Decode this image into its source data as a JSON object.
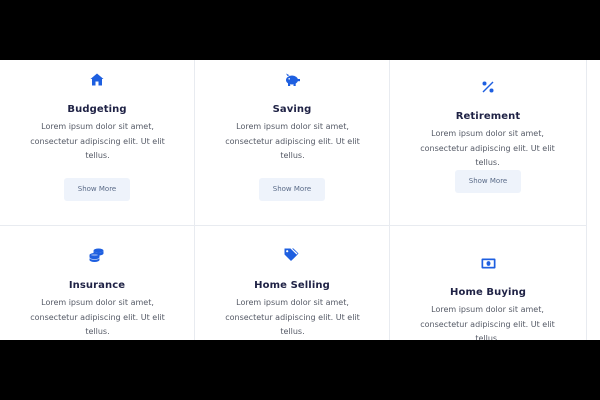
{
  "colors": {
    "accent": "#1e5fe0",
    "title": "#1f2245",
    "text": "#555a66",
    "button_bg": "#eef3fb",
    "border": "#e8ebf0"
  },
  "services": [
    {
      "title": "Budgeting",
      "icon": "home-icon",
      "description": "Lorem ipsum dolor sit amet, consectetur adipiscing elit. Ut elit tellus.",
      "button": "Show More"
    },
    {
      "title": "Saving",
      "icon": "piggy-bank-icon",
      "description": "Lorem ipsum dolor sit amet, consectetur adipiscing elit. Ut elit tellus.",
      "button": "Show More"
    },
    {
      "title": "Retirement",
      "icon": "percent-icon",
      "description": "Lorem ipsum dolor sit amet, consectetur adipiscing elit. Ut elit tellus.",
      "button": "Show More"
    },
    {
      "title": "Insurance",
      "icon": "coins-icon",
      "description": "Lorem ipsum dolor sit amet, consectetur adipiscing elit. Ut elit tellus."
    },
    {
      "title": "Home Selling",
      "icon": "tags-icon",
      "description": "Lorem ipsum dolor sit amet, consectetur adipiscing elit. Ut elit tellus."
    },
    {
      "title": "Home Buying",
      "icon": "money-bill-icon",
      "description": "Lorem ipsum dolor sit amet, consectetur adipiscing elit. Ut elit tellus."
    }
  ]
}
